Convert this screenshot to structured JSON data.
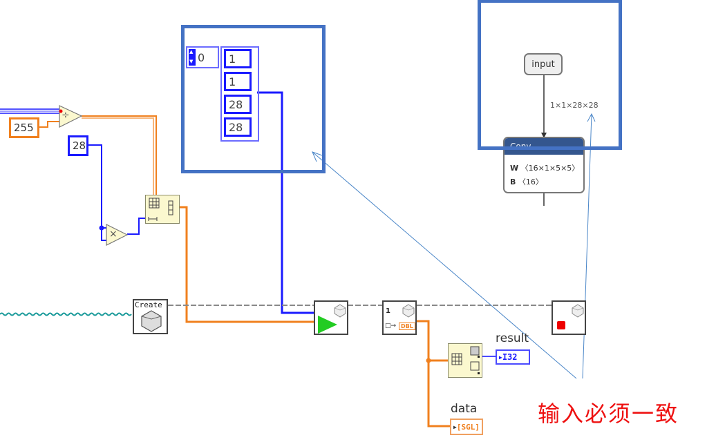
{
  "diagram": {
    "constants": {
      "divisor": "255",
      "image_size": "28"
    },
    "operators": {
      "divide_symbol": "÷",
      "multiply_symbol": "×"
    },
    "shape_array": {
      "index": "0",
      "values": [
        "1",
        "1",
        "28",
        "28"
      ]
    },
    "nodes": {
      "create_label": "Create",
      "get_output_index": "1",
      "get_output_type": "DBL"
    },
    "indicators": {
      "result_label": "result",
      "result_type": "I32",
      "data_label": "data",
      "data_type": "SGL"
    },
    "onnx_graph": {
      "input_node_label": "input",
      "edge_shape": "1×1×28×28",
      "conv_title": "Conv",
      "conv_weight_label": "W",
      "conv_weight_shape": "〈16×1×5×5〉",
      "conv_bias_label": "B",
      "conv_bias_shape": "〈16〉"
    },
    "annotation": {
      "note": "输入必须一致"
    },
    "colors": {
      "highlight_box": "#4472c4",
      "wire_int": "#1a1aff",
      "wire_float": "#f0801e",
      "note_text": "#ee1111",
      "node_yellow": "#fbf8cf"
    }
  }
}
